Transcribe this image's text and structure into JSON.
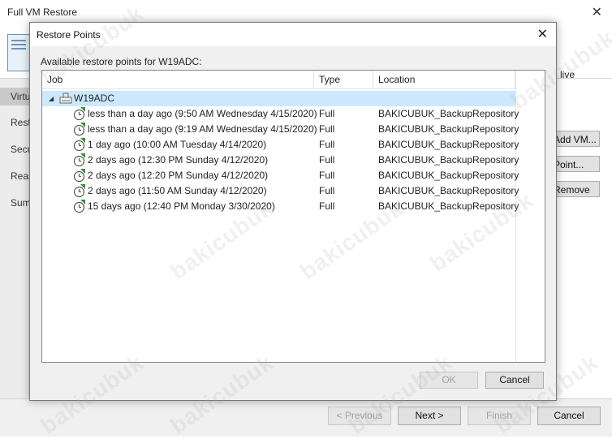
{
  "wizard": {
    "title": "Full VM Restore",
    "close_glyph": "✕",
    "header_text": "live",
    "steps": [
      "Virtual Machines",
      "Restore Mode",
      "Secure Restore",
      "Reason",
      "Summary"
    ],
    "side_buttons": [
      "Add VM...",
      "Point...",
      "Remove"
    ],
    "footer": {
      "previous": "< Previous",
      "next": "Next >",
      "finish": "Finish",
      "cancel": "Cancel"
    }
  },
  "dialog": {
    "title": "Restore Points",
    "close_glyph": "✕",
    "label": "Available restore points for W19ADC:",
    "columns": {
      "job": "Job",
      "type": "Type",
      "location": "Location"
    },
    "group": {
      "expander": "◢",
      "name": "W19ADC"
    },
    "rows": [
      {
        "job": "less than a day ago (9:50 AM Wednesday 4/15/2020)",
        "type": "Full",
        "location": "BAKICUBUK_BackupRepository"
      },
      {
        "job": "less than a day ago (9:19 AM Wednesday 4/15/2020)",
        "type": "Full",
        "location": "BAKICUBUK_BackupRepository"
      },
      {
        "job": "1 day ago (10:00 AM Tuesday 4/14/2020)",
        "type": "Full",
        "location": "BAKICUBUK_BackupRepository"
      },
      {
        "job": "2 days ago (12:30 PM Sunday 4/12/2020)",
        "type": "Full",
        "location": "BAKICUBUK_BackupRepository"
      },
      {
        "job": "2 days ago (12:20 PM Sunday 4/12/2020)",
        "type": "Full",
        "location": "BAKICUBUK_BackupRepository"
      },
      {
        "job": "2 days ago (11:50 AM Sunday 4/12/2020)",
        "type": "Full",
        "location": "BAKICUBUK_BackupRepository"
      },
      {
        "job": "15 days ago (12:40 PM Monday 3/30/2020)",
        "type": "Full",
        "location": "BAKICUBUK_BackupRepository"
      }
    ],
    "ok": "OK",
    "cancel": "Cancel"
  },
  "watermark": "bakicubuk",
  "colors": {
    "selection": "#cce8ff",
    "accent": "#3c8d3c"
  }
}
